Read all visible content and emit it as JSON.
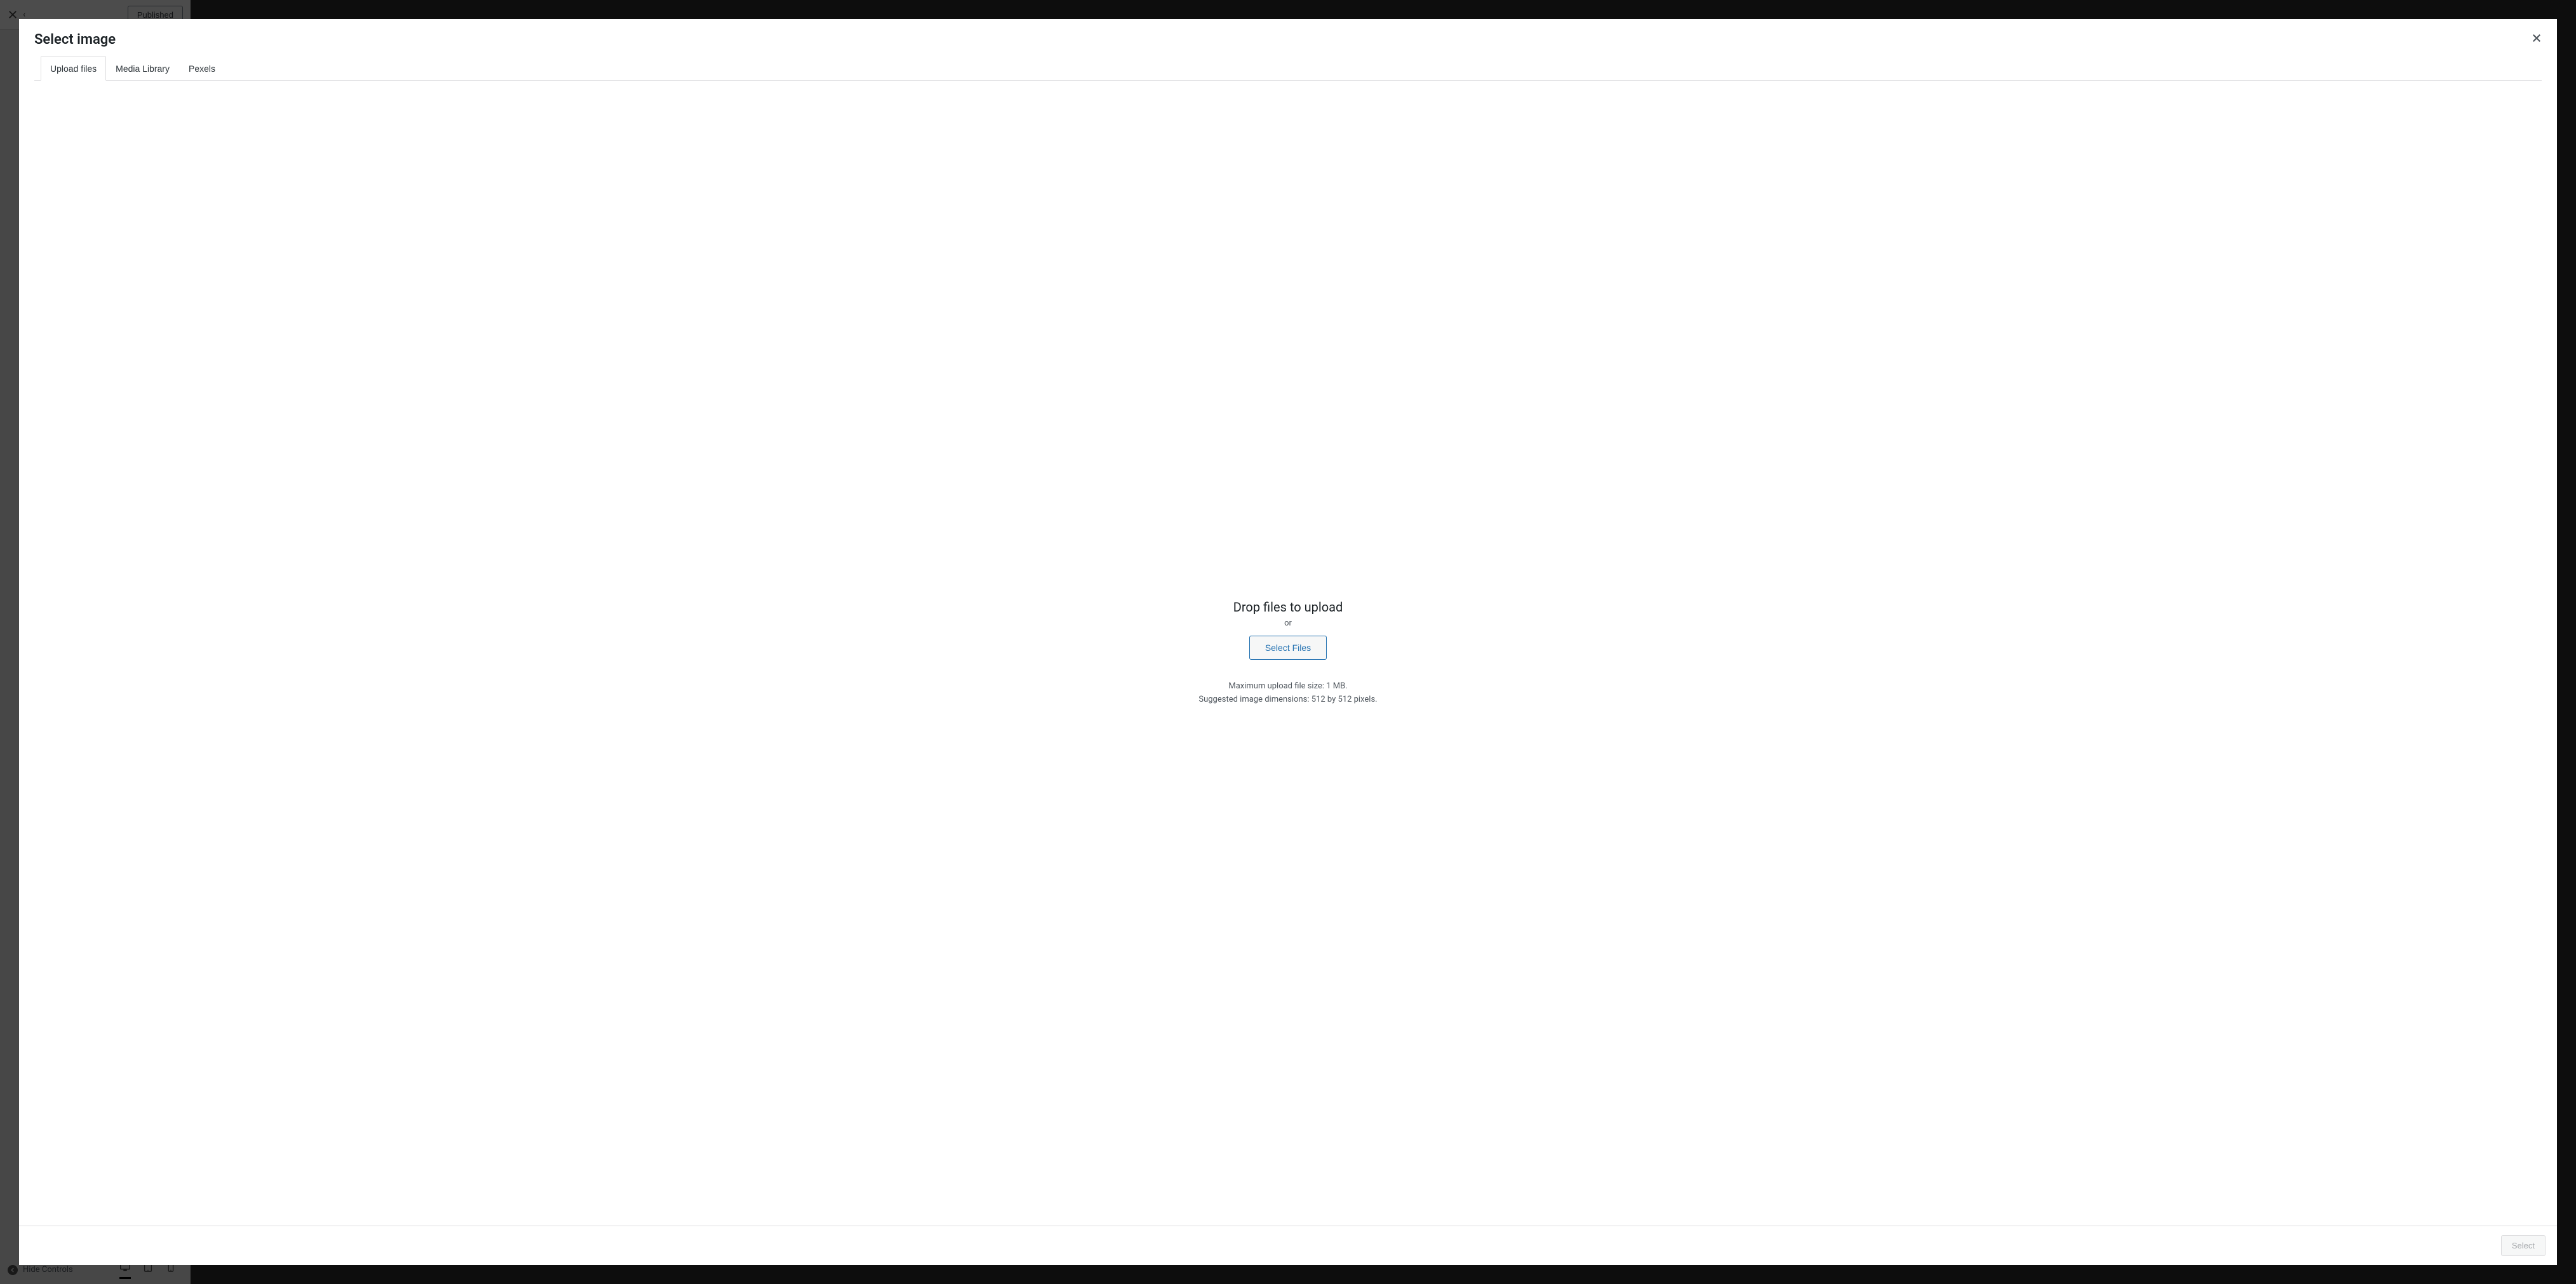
{
  "bg_panel": {
    "published_label": "Published",
    "hide_controls_label": "Hide Controls"
  },
  "modal": {
    "title": "Select image",
    "tabs": [
      {
        "label": "Upload files"
      },
      {
        "label": "Media Library"
      },
      {
        "label": "Pexels"
      }
    ],
    "drop_title": "Drop files to upload",
    "drop_or": "or",
    "select_files_label": "Select Files",
    "max_size_text": "Maximum upload file size: 1 MB.",
    "dimensions_text": "Suggested image dimensions: 512 by 512 pixels.",
    "footer_select_label": "Select"
  }
}
